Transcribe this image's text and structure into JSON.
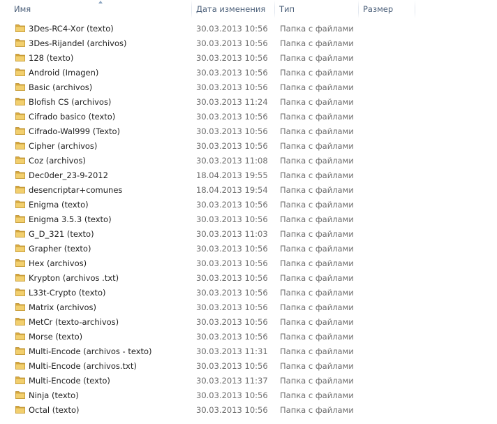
{
  "columns": {
    "name": "Имя",
    "modified": "Дата изменения",
    "type": "Тип",
    "size": "Размер"
  },
  "folder_type": "Папка с файлами",
  "icons": {
    "folder": "folder-icon",
    "sort": "sort-ascending-icon"
  },
  "colors": {
    "header_text": "#4c607a",
    "meta_text": "#6d6d6d",
    "folder": "#e8c15a"
  },
  "items": [
    {
      "name": "3Des-RC4-Xor (texto)",
      "modified": "30.03.2013 10:56",
      "type": "Папка с файлами"
    },
    {
      "name": "3Des-Rijandel (archivos)",
      "modified": "30.03.2013 10:56",
      "type": "Папка с файлами"
    },
    {
      "name": "128 (texto)",
      "modified": "30.03.2013 10:56",
      "type": "Папка с файлами"
    },
    {
      "name": "Android (Imagen)",
      "modified": "30.03.2013 10:56",
      "type": "Папка с файлами"
    },
    {
      "name": "Basic (archivos)",
      "modified": "30.03.2013 10:56",
      "type": "Папка с файлами"
    },
    {
      "name": "Blofish CS (archivos)",
      "modified": "30.03.2013 11:24",
      "type": "Папка с файлами"
    },
    {
      "name": "Cifrado basico (texto)",
      "modified": "30.03.2013 10:56",
      "type": "Папка с файлами"
    },
    {
      "name": "Cifrado-Wal999 (Texto)",
      "modified": "30.03.2013 10:56",
      "type": "Папка с файлами"
    },
    {
      "name": "Cipher (archivos)",
      "modified": "30.03.2013 10:56",
      "type": "Папка с файлами"
    },
    {
      "name": "Coz (archivos)",
      "modified": "30.03.2013 11:08",
      "type": "Папка с файлами"
    },
    {
      "name": "Dec0der_23-9-2012",
      "modified": "18.04.2013 19:55",
      "type": "Папка с файлами"
    },
    {
      "name": "desencriptar+comunes",
      "modified": "18.04.2013 19:54",
      "type": "Папка с файлами"
    },
    {
      "name": "Enigma  (texto)",
      "modified": "30.03.2013 10:56",
      "type": "Папка с файлами"
    },
    {
      "name": "Enigma 3.5.3 (texto)",
      "modified": "30.03.2013 10:56",
      "type": "Папка с файлами"
    },
    {
      "name": "G_D_321 (texto)",
      "modified": "30.03.2013 11:03",
      "type": "Папка с файлами"
    },
    {
      "name": "Grapher (texto)",
      "modified": "30.03.2013 10:56",
      "type": "Папка с файлами"
    },
    {
      "name": "Hex (archivos)",
      "modified": "30.03.2013 10:56",
      "type": "Папка с файлами"
    },
    {
      "name": "Krypton (archivos .txt)",
      "modified": "30.03.2013 10:56",
      "type": "Папка с файлами"
    },
    {
      "name": "L33t-Crypto (texto)",
      "modified": "30.03.2013 10:56",
      "type": "Папка с файлами"
    },
    {
      "name": "Matrix (archivos)",
      "modified": "30.03.2013 10:56",
      "type": "Папка с файлами"
    },
    {
      "name": "MetCr (texto-archivos)",
      "modified": "30.03.2013 10:56",
      "type": "Папка с файлами"
    },
    {
      "name": "Morse (texto)",
      "modified": "30.03.2013 10:56",
      "type": "Папка с файлами"
    },
    {
      "name": "Multi-Encode (archivos - texto)",
      "modified": "30.03.2013 11:31",
      "type": "Папка с файлами"
    },
    {
      "name": "Multi-Encode (archivos.txt)",
      "modified": "30.03.2013 10:56",
      "type": "Папка с файлами"
    },
    {
      "name": "Multi-Encode (texto)",
      "modified": "30.03.2013 11:37",
      "type": "Папка с файлами"
    },
    {
      "name": "Ninja (texto)",
      "modified": "30.03.2013 10:56",
      "type": "Папка с файлами"
    },
    {
      "name": "Octal (texto)",
      "modified": "30.03.2013 10:56",
      "type": "Папка с файлами"
    }
  ]
}
